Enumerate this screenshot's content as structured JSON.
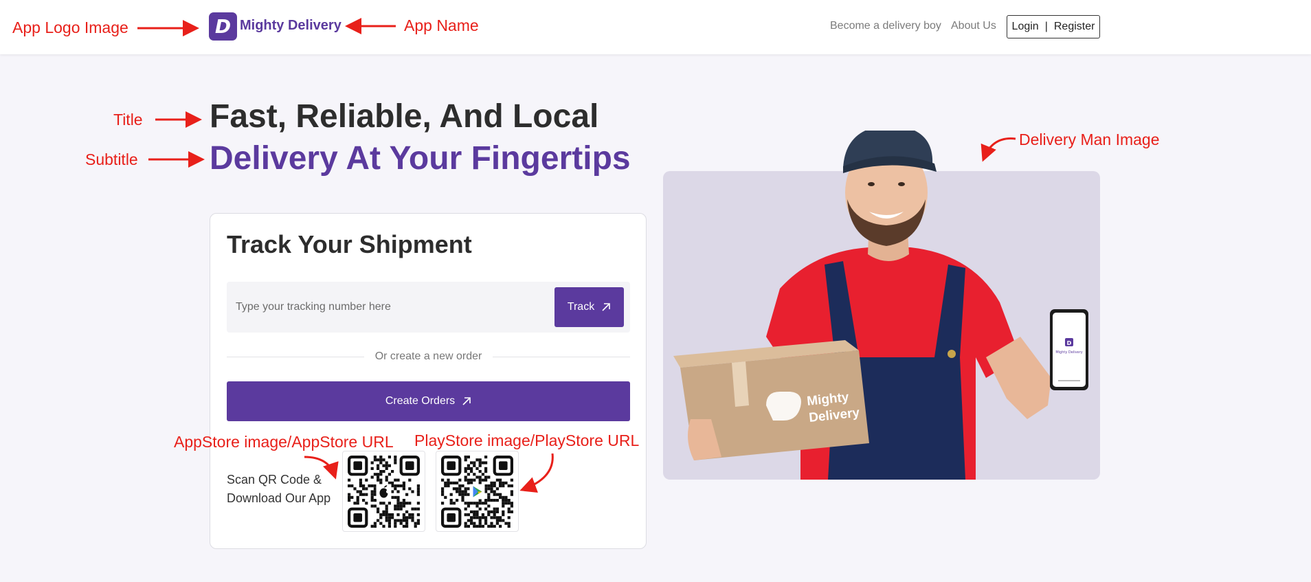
{
  "header": {
    "app_name": "Mighty Delivery",
    "logo_letter": "D",
    "nav": {
      "become_delivery_boy": "Become a delivery boy",
      "about_us": "About Us",
      "login": "Login",
      "separator": "|",
      "register": "Register"
    }
  },
  "hero": {
    "title": "Fast, Reliable, And Local",
    "subtitle": "Delivery At Your Fingertips"
  },
  "track_card": {
    "title": "Track Your Shipment",
    "input_placeholder": "Type your tracking number here",
    "input_value": "",
    "track_button": "Track",
    "divider_text": "Or create a new order",
    "create_button": "Create Orders",
    "scan_text": "Scan QR Code & Download Our App"
  },
  "illustration": {
    "box_brand_line1": "Mighty",
    "box_brand_line2": "Delivery",
    "phone_app_name": "Mighty Delivery"
  },
  "annotations": {
    "app_logo_image": "App Logo Image",
    "app_name": "App Name",
    "title": "Title",
    "subtitle": "Subtitle",
    "delivery_man_image": "Delivery Man Image",
    "appstore": "AppStore image/AppStore URL",
    "playstore": "PlayStore image/PlayStore URL"
  },
  "colors": {
    "brand": "#5b3a9e",
    "annotation": "#e8201a",
    "page_bg": "#f6f5fa",
    "image_bg": "#dcd8e7"
  },
  "icons": {
    "arrow": "arrow-up-right-icon",
    "apple": "apple-icon",
    "play": "google-play-icon"
  }
}
